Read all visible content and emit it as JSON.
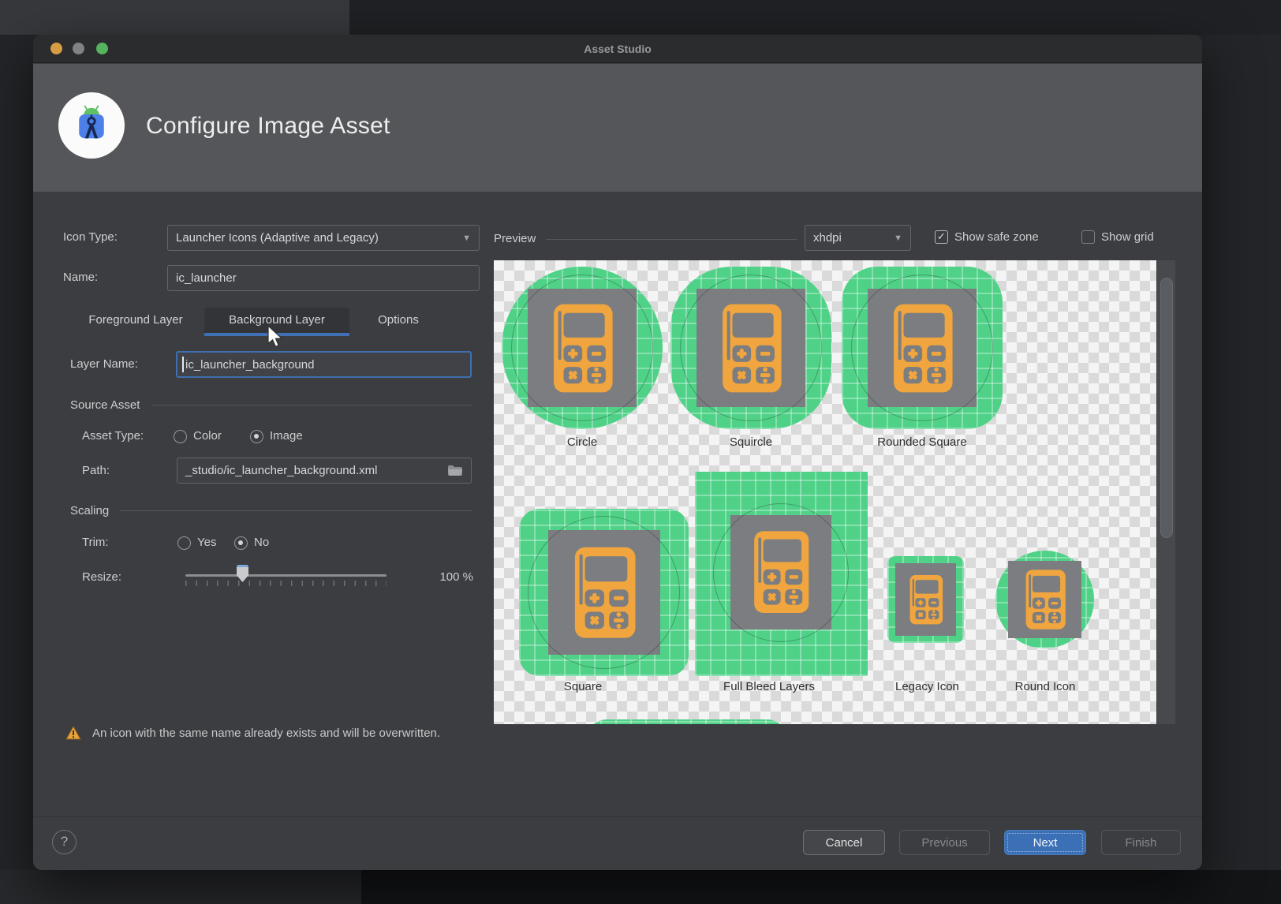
{
  "window": {
    "title": "Asset Studio"
  },
  "header": {
    "title": "Configure Image Asset"
  },
  "form": {
    "icon_type_label": "Icon Type:",
    "icon_type_value": "Launcher Icons (Adaptive and Legacy)",
    "name_label": "Name:",
    "name_value": "ic_launcher",
    "tabs": [
      {
        "label": "Foreground Layer",
        "active": false
      },
      {
        "label": "Background Layer",
        "active": true
      },
      {
        "label": "Options",
        "active": false
      }
    ],
    "layer_name_label": "Layer Name:",
    "layer_name_value": "ic_launcher_background",
    "source_asset_section": "Source Asset",
    "asset_type_label": "Asset Type:",
    "asset_type_options": [
      {
        "label": "Color",
        "selected": false
      },
      {
        "label": "Image",
        "selected": true
      }
    ],
    "path_label": "Path:",
    "path_value": "_studio/ic_launcher_background.xml",
    "scaling_section": "Scaling",
    "trim_label": "Trim:",
    "trim_options": [
      {
        "label": "Yes",
        "selected": false
      },
      {
        "label": "No",
        "selected": true
      }
    ],
    "resize_label": "Resize:",
    "resize_value": "100 %"
  },
  "preview": {
    "label": "Preview",
    "density_value": "xhdpi",
    "show_safe_zone": {
      "label": "Show safe zone",
      "checked": true
    },
    "show_grid": {
      "label": "Show grid",
      "checked": false
    },
    "tiles": [
      {
        "label": "Circle"
      },
      {
        "label": "Squircle"
      },
      {
        "label": "Rounded Square"
      },
      {
        "label": "Square"
      },
      {
        "label": "Full Bleed Layers"
      },
      {
        "label": "Legacy Icon"
      },
      {
        "label": "Round Icon"
      }
    ]
  },
  "warning": {
    "text": "An icon with the same name already exists and will be overwritten."
  },
  "footer": {
    "help_label": "?",
    "buttons": [
      {
        "label": "Cancel",
        "style": "normal"
      },
      {
        "label": "Previous",
        "style": "disabled"
      },
      {
        "label": "Next",
        "style": "primary"
      },
      {
        "label": "Finish",
        "style": "disabled"
      }
    ]
  },
  "icons": {
    "dropdown_arrow": "▼",
    "checkmark": "✓"
  },
  "colors": {
    "accent_blue": "#3f70b6",
    "preview_green": "#4fd287",
    "icon_orange": "#f0a53e",
    "layer_gray": "#7b7d80",
    "warning_amber": "#e8a33d"
  }
}
